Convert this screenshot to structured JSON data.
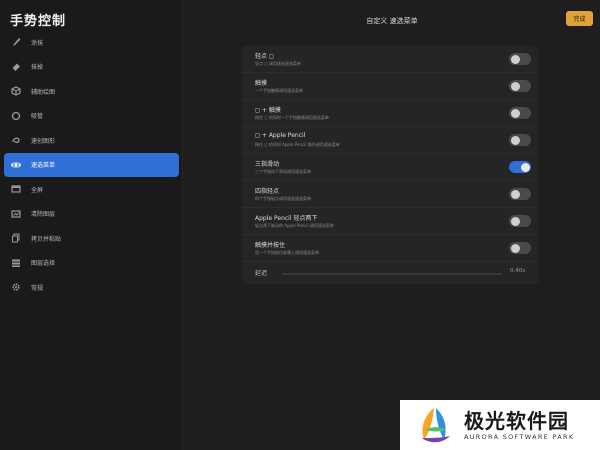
{
  "sidebar": {
    "title": "手势控制",
    "items": [
      {
        "label": "涂抹",
        "icon": "brush-icon",
        "active": false
      },
      {
        "label": "抹掉",
        "icon": "eraser-icon",
        "active": false
      },
      {
        "label": "辅助绘图",
        "icon": "cube-icon",
        "active": false
      },
      {
        "label": "吸管",
        "icon": "eyedropper-icon",
        "active": false
      },
      {
        "label": "速创图形",
        "icon": "quickshape-icon",
        "active": false
      },
      {
        "label": "速选菜单",
        "icon": "quickmenu-icon",
        "active": true
      },
      {
        "label": "全屏",
        "icon": "fullscreen-icon",
        "active": false
      },
      {
        "label": "清除图层",
        "icon": "clear-layer-icon",
        "active": false
      },
      {
        "label": "拷贝并粘贴",
        "icon": "copy-paste-icon",
        "active": false
      },
      {
        "label": "图层选择",
        "icon": "layer-select-icon",
        "active": false
      },
      {
        "label": "常规",
        "icon": "gear-icon",
        "active": false
      }
    ]
  },
  "header": {
    "title": "自定义 速选菜单",
    "done_label": "完成"
  },
  "settings": [
    {
      "title": "轻点 ◻",
      "subtitle": "轻点 ◻ 调用速选速选菜单",
      "on": false
    },
    {
      "title": "触摸",
      "subtitle": "一个手指触摸调用速选菜单",
      "on": false
    },
    {
      "title": "◻ + 触摸",
      "subtitle": "按住 ◻ 的同时一个手指触摸调用速选菜单",
      "on": false
    },
    {
      "title": "◻ + Apple Pencil",
      "subtitle": "按住 ◻ 的同时 Apple Pencil 操作调用速选菜单",
      "on": false
    },
    {
      "title": "三指滑动",
      "subtitle": "三个手指向下滑动调用速选菜单",
      "on": true
    },
    {
      "title": "四指轻点",
      "subtitle": "四个手指轻点调用速选速选菜单",
      "on": false
    },
    {
      "title": "Apple Pencil 轻点两下",
      "subtitle": "轻点两下被动的 Apple Pencil 调用速选菜单",
      "on": false
    },
    {
      "title": "触摸并按住",
      "subtitle": "用一个手指按住屏幕上调用速选菜单",
      "on": false
    }
  ],
  "delay": {
    "label": "延迟",
    "value_text": "0.40s",
    "fraction": 0.0
  },
  "watermark": {
    "name": "极光软件园",
    "name_en": "AURORA SOFTWARE PARK"
  },
  "colors": {
    "accent": "#2f6fd6",
    "done": "#e2a23b"
  }
}
